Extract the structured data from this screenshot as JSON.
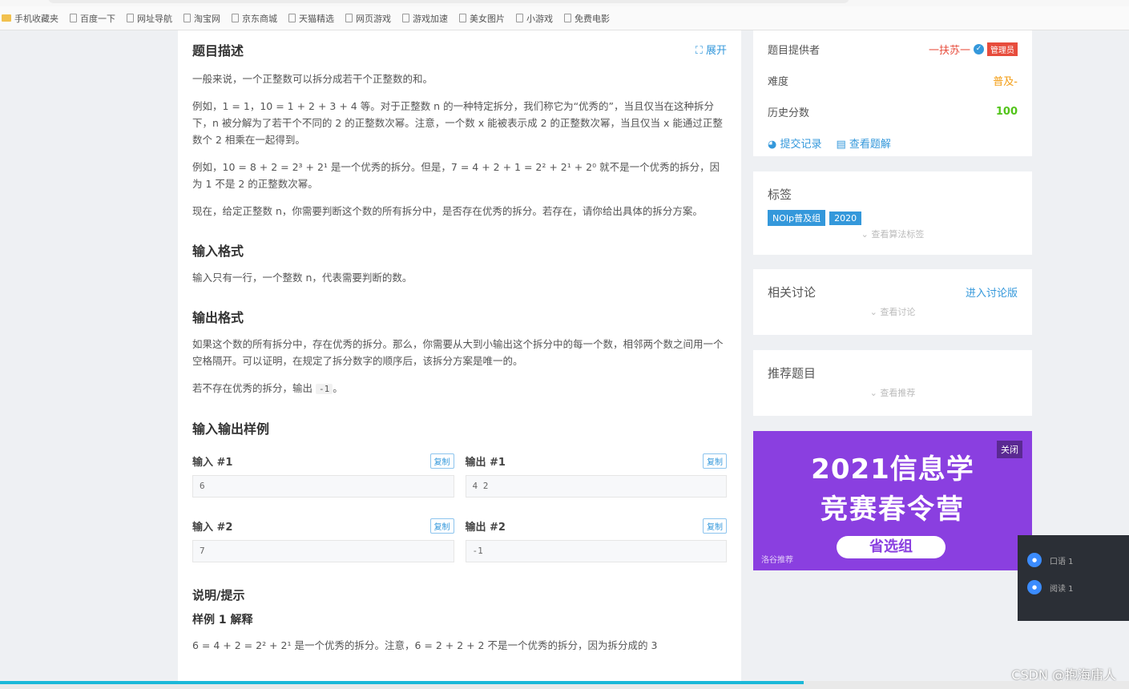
{
  "bookmarks": [
    "手机收藏夹",
    "百度一下",
    "网址导航",
    "淘宝网",
    "京东商城",
    "天猫精选",
    "网页游戏",
    "游戏加速",
    "美女图片",
    "小游戏",
    "免费电影"
  ],
  "problem": {
    "desc_title": "题目描述",
    "expand_label": "⛶ 展开",
    "p1": "一般来说，一个正整数可以拆分成若干个正整数的和。",
    "p2": "例如，1 = 1，10 = 1 + 2 + 3 + 4 等。对于正整数 n 的一种特定拆分，我们称它为“优秀的”，当且仅当在这种拆分下，n 被分解为了若干个不同的 2 的正整数次幂。注意，一个数 x 能被表示成 2 的正整数次幂，当且仅当 x 能通过正整数个 2 相乘在一起得到。",
    "p3": "例如，10 = 8 + 2 = 2³ + 2¹ 是一个优秀的拆分。但是，7 = 4 + 2 + 1 = 2² + 2¹ + 2⁰ 就不是一个优秀的拆分，因为 1 不是 2 的正整数次幂。",
    "p4": "现在，给定正整数 n，你需要判断这个数的所有拆分中，是否存在优秀的拆分。若存在，请你给出具体的拆分方案。",
    "input_title": "输入格式",
    "input_text": "输入只有一行，一个整数 n，代表需要判断的数。",
    "output_title": "输出格式",
    "output_text": "如果这个数的所有拆分中，存在优秀的拆分。那么，你需要从大到小输出这个拆分中的每一个数，相邻两个数之间用一个空格隔开。可以证明，在规定了拆分数字的顺序后，该拆分方案是唯一的。",
    "output_text2_a": "若不存在优秀的拆分，输出",
    "output_code": "-1",
    "output_text2_b": "。",
    "samples_title": "输入输出样例",
    "copy_label": "复制",
    "samples": [
      {
        "in_label": "输入 #1",
        "in_val": "6",
        "out_label": "输出 #1",
        "out_val": "4 2"
      },
      {
        "in_label": "输入 #2",
        "in_val": "7",
        "out_label": "输出 #2",
        "out_val": "-1"
      }
    ],
    "hint_title": "说明/提示",
    "hint_sub": "样例 1 解释",
    "hint_line": "6 = 4 + 2 = 2² + 2¹ 是一个优秀的拆分。注意，6 = 2 + 2 + 2 不是一个优秀的拆分，因为拆分成的 3"
  },
  "info": {
    "provider_label": "题目提供者",
    "provider_name": "一扶苏一",
    "provider_badge": "管理员",
    "difficulty_label": "难度",
    "difficulty_value": "普及-",
    "score_label": "历史分数",
    "score_value": "100",
    "submit_link": "提交记录",
    "solution_link": "查看题解"
  },
  "tags": {
    "title": "标签",
    "items": [
      "NOIp普及组",
      "2020"
    ],
    "more": "查看算法标签"
  },
  "discuss": {
    "title": "相关讨论",
    "enter": "进入讨论版",
    "more": "查看讨论"
  },
  "recommend": {
    "title": "推荐题目",
    "more": "查看推荐"
  },
  "banner": {
    "line1": "2021信息学",
    "line2": "竞赛春令营",
    "pill": "省选组",
    "close": "关闭",
    "ad": "洛谷推荐"
  },
  "float": {
    "row1": "口语 1",
    "row2": "阅读 1"
  },
  "watermark": "CSDN @抱海庸人",
  "colors": {
    "link": "#3498db",
    "difficulty": "#f39c11",
    "score": "#52c41a",
    "badge": "#e74c3c",
    "banner": "#8a3fe0"
  }
}
